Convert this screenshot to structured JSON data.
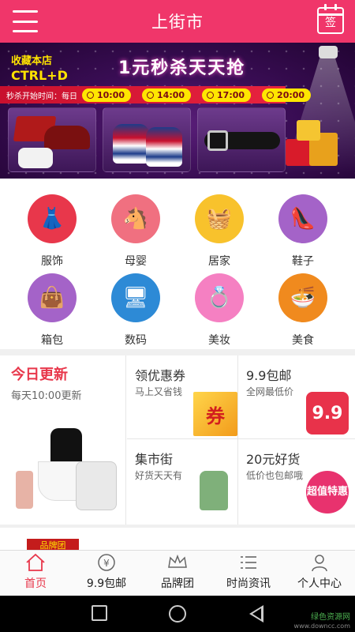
{
  "header": {
    "title": "上街市",
    "sign_label": "签"
  },
  "banner": {
    "collect_text": "收藏本店",
    "shortcut": "CTRL+D",
    "headline": "1元秒杀天天抢",
    "time_label": "秒杀开始时间：每日",
    "times": [
      "10:00",
      "14:00",
      "17:00",
      "20:00"
    ]
  },
  "categories": [
    {
      "label": "服饰",
      "icon": "dress-icon",
      "color": "#e8374b"
    },
    {
      "label": "母婴",
      "icon": "rocking-horse-icon",
      "color": "#f07080"
    },
    {
      "label": "居家",
      "icon": "basket-icon",
      "color": "#f8c22c"
    },
    {
      "label": "鞋子",
      "icon": "high-heel-icon",
      "color": "#a463c8"
    },
    {
      "label": "箱包",
      "icon": "handbag-icon",
      "color": "#a463c8"
    },
    {
      "label": "数码",
      "icon": "devices-icon",
      "color": "#2d8ad6"
    },
    {
      "label": "美妆",
      "icon": "ring-icon",
      "color": "#f580c2"
    },
    {
      "label": "美食",
      "icon": "noodle-bowl-icon",
      "color": "#f08a1e"
    }
  ],
  "promo": {
    "today": {
      "title": "今日更新",
      "subtitle": "每天10:00更新"
    },
    "cells": [
      {
        "title": "领优惠券",
        "subtitle": "马上又省钱",
        "badge": "券"
      },
      {
        "title": "9.9包邮",
        "subtitle": "全网最低价",
        "badge": "9.9"
      },
      {
        "title": "集市街",
        "subtitle": "好货天天有"
      },
      {
        "title": "20元好货",
        "subtitle": "低价也包邮哦",
        "badge": "超值特惠"
      }
    ]
  },
  "peek": {
    "brand_text": "品牌团"
  },
  "tabbar": [
    {
      "label": "首页",
      "icon": "home-icon",
      "active": true
    },
    {
      "label": "9.9包邮",
      "icon": "yen-circle-icon"
    },
    {
      "label": "品牌团",
      "icon": "crown-icon"
    },
    {
      "label": "时尚资讯",
      "icon": "list-icon"
    },
    {
      "label": "个人中心",
      "icon": "user-icon"
    }
  ],
  "watermark": {
    "line1": "绿色资源网",
    "line2": "www.downcc.com"
  },
  "colors": {
    "accent": "#f0366a",
    "highlight": "#e8374b",
    "banner_bg": "#3a0d55"
  }
}
